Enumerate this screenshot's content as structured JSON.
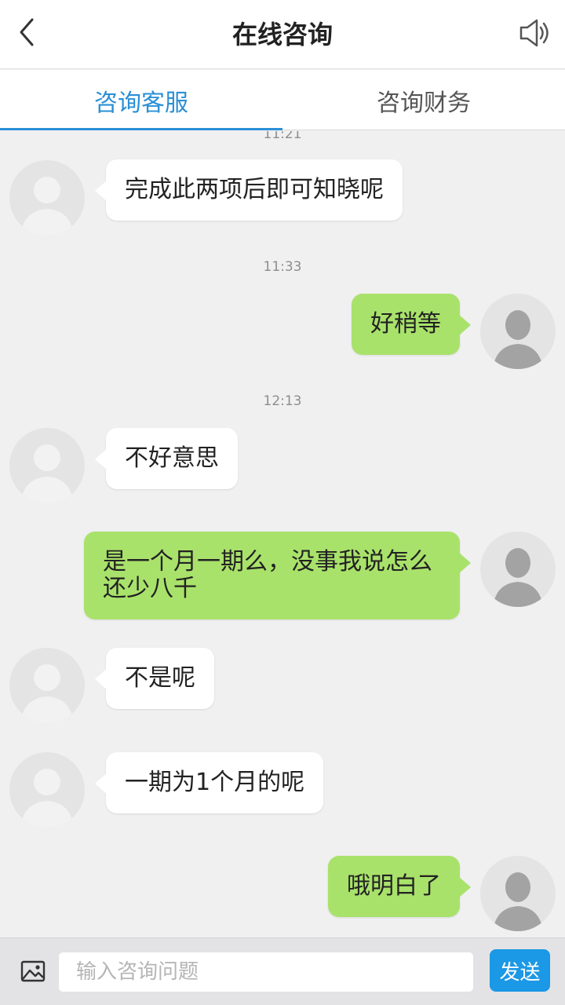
{
  "header": {
    "title": "在线咨询",
    "back_icon": "chevron-left-icon",
    "sound_icon": "speaker-icon"
  },
  "tabs": [
    {
      "label": "咨询客服",
      "active": true
    },
    {
      "label": "咨询财务",
      "active": false
    }
  ],
  "chat": {
    "times": [
      "11:21",
      "11:33",
      "12:13"
    ],
    "messages": [
      {
        "side": "left",
        "text": "完成此两项后即可知晓呢"
      },
      {
        "side": "right",
        "text": "好稍等"
      },
      {
        "side": "left",
        "text": "不好意思"
      },
      {
        "side": "right",
        "text": "是一个月一期么，没事我说怎么还少八千"
      },
      {
        "side": "left",
        "text": "不是呢"
      },
      {
        "side": "left",
        "text": "一期为1个月的呢"
      },
      {
        "side": "right",
        "text": "哦明白了"
      }
    ]
  },
  "composer": {
    "image_icon": "image-icon",
    "placeholder": "输入咨询问题",
    "send_label": "发送"
  },
  "colors": {
    "accent": "#2a8fd6",
    "send_button": "#1b98e6",
    "bubble_right": "#a9e26b",
    "bubble_left": "#ffffff",
    "chat_background": "#f0f0f0"
  }
}
